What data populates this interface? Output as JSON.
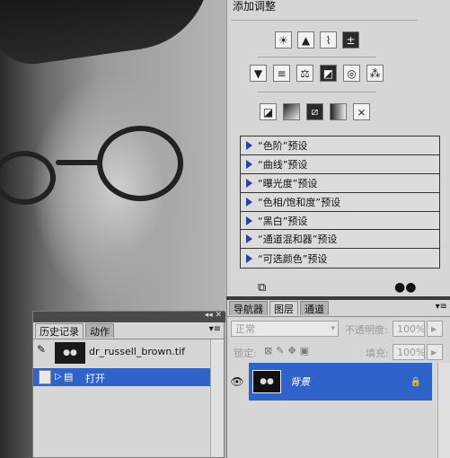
{
  "adjustments_panel": {
    "title": "添加调整",
    "icon_rows": [
      [
        "brightness-contrast-icon",
        "levels-icon",
        "curves-icon",
        "exposure-icon"
      ],
      [
        "vibrance-icon",
        "hue-saturation-icon",
        "color-balance-icon",
        "black-white-icon",
        "photo-filter-icon",
        "channel-mixer-icon"
      ],
      [
        "invert-icon",
        "posterize-icon",
        "threshold-icon",
        "gradient-map-icon",
        "selective-color-icon"
      ]
    ],
    "presets": [
      "“色阶”预设",
      "“曲线”预设",
      "“曝光度”预设",
      "“色相/饱和度”预设",
      "“黑白”预设",
      "“通道混和器”预设",
      "“可选颜色”预设"
    ]
  },
  "history_panel": {
    "tabs": [
      "历史记录",
      "动作"
    ],
    "active_tab": 0,
    "snapshot_name": "dr_russell_brown.tif",
    "step_label": "打开"
  },
  "layers_panel": {
    "tabs": [
      "导航器",
      "图层",
      "通道"
    ],
    "active_tab": 1,
    "blend_mode": "正常",
    "opacity_label": "不透明度:",
    "opacity_value": "100%",
    "lock_label": "锁定:",
    "fill_label": "填充:",
    "fill_value": "100%",
    "layer_name": "背景"
  },
  "colors": {
    "selection": "#2f63c9",
    "panel_bg": "#d6d6d6",
    "triangle": "#2f3f9a"
  }
}
